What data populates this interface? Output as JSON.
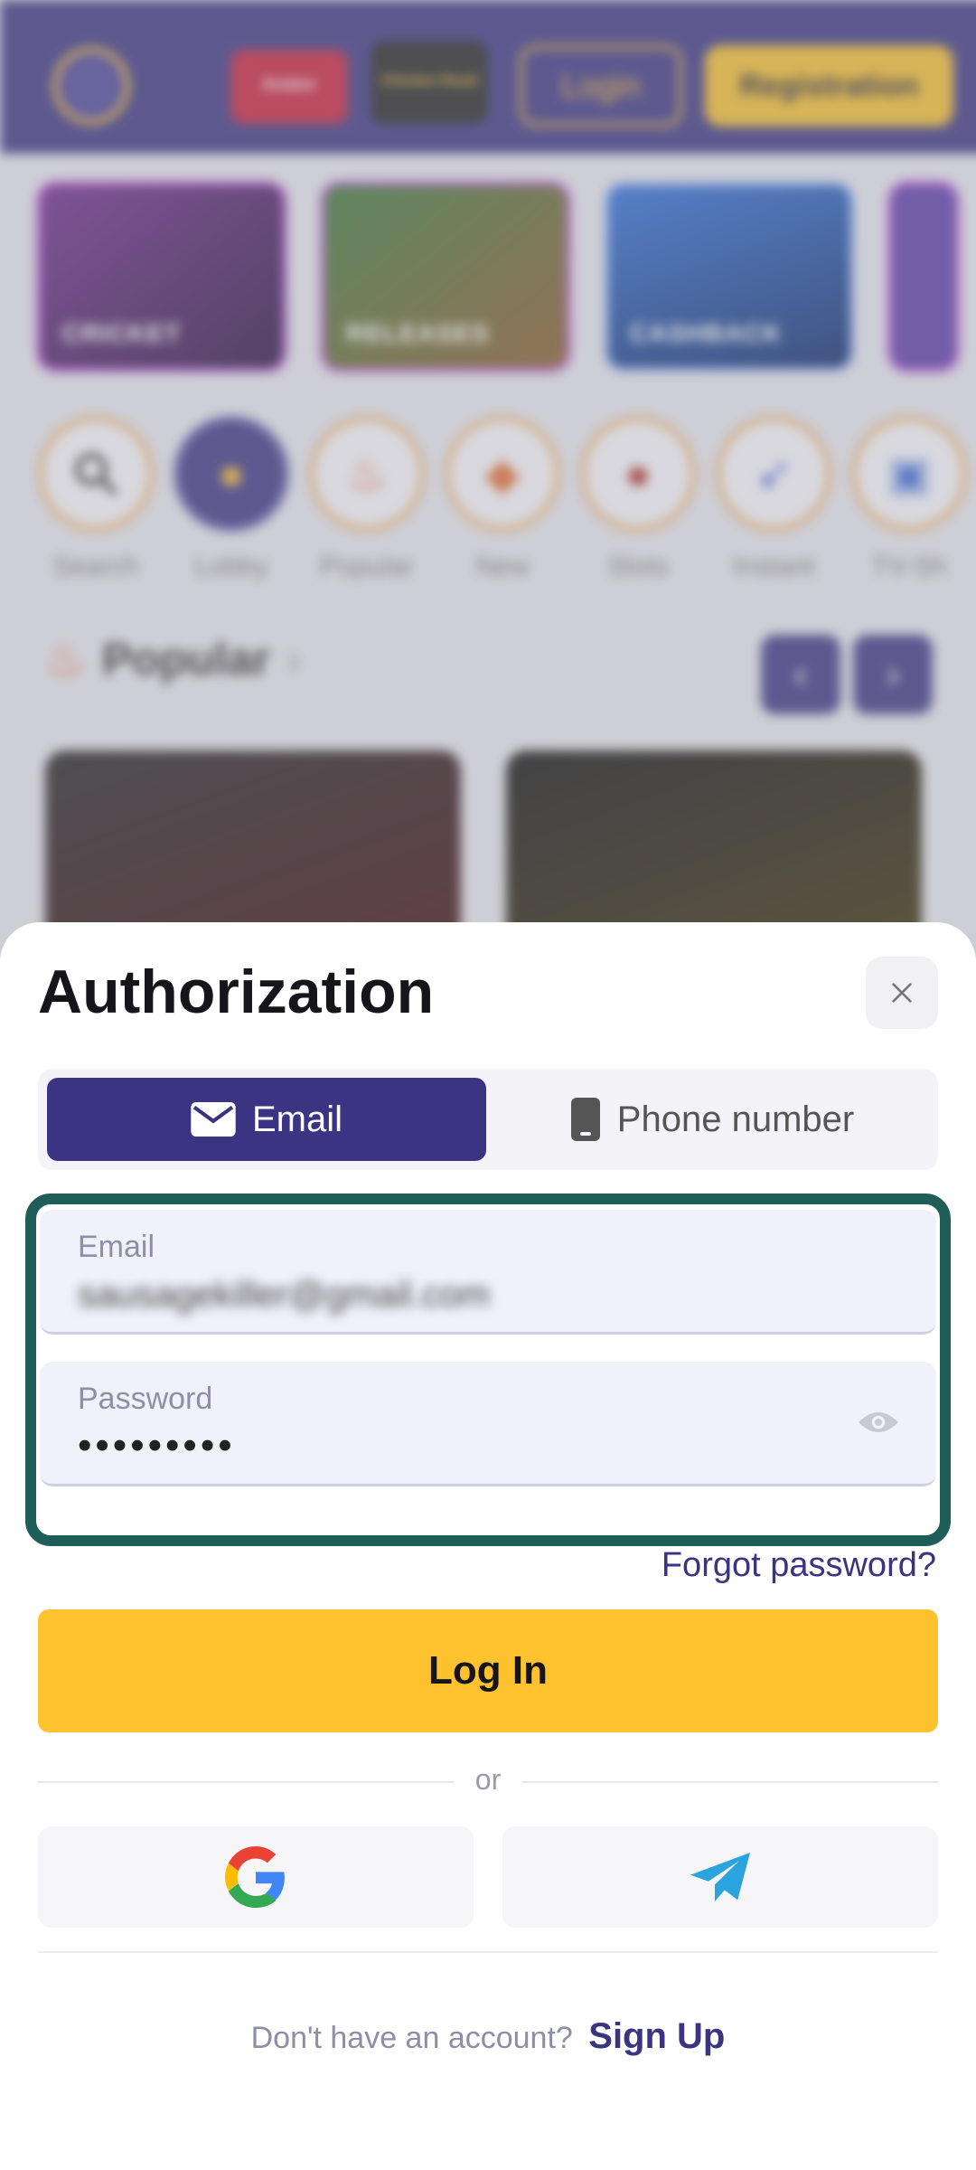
{
  "background": {
    "header": {
      "login_label": "Login",
      "registration_label": "Registration",
      "promo_1": "Aviator",
      "promo_2": "Chicken Road"
    },
    "cards": [
      {
        "label": "CRICKET"
      },
      {
        "label": "RELEASES"
      },
      {
        "label": "CASHBACK"
      }
    ],
    "categories": [
      {
        "label": "Search",
        "icon": "search-icon"
      },
      {
        "label": "Lobby",
        "icon": "lobby-icon"
      },
      {
        "label": "Popular",
        "icon": "fire-icon"
      },
      {
        "label": "New",
        "icon": "new-icon"
      },
      {
        "label": "Slots",
        "icon": "slots-icon"
      },
      {
        "label": "Instant",
        "icon": "rocket-icon"
      },
      {
        "label": "TV-Sh",
        "icon": "tv-icon"
      }
    ],
    "popular_title": "Popular"
  },
  "sheet": {
    "title": "Authorization",
    "tabs": [
      {
        "label": "Email",
        "active": true
      },
      {
        "label": "Phone number",
        "active": false
      }
    ],
    "email_field": {
      "label": "Email",
      "value": "sausagekiller@gmail.com"
    },
    "password_field": {
      "label": "Password",
      "value": "•••••••••"
    },
    "forgot_password": "Forgot password?",
    "login_button": "Log In",
    "divider_text": "or",
    "signup_prompt": "Don't have an account?",
    "signup_link": "Sign Up"
  },
  "colors": {
    "brand": "#3a3482",
    "accent": "#fdc22d",
    "highlight_frame": "#1f5e58"
  }
}
